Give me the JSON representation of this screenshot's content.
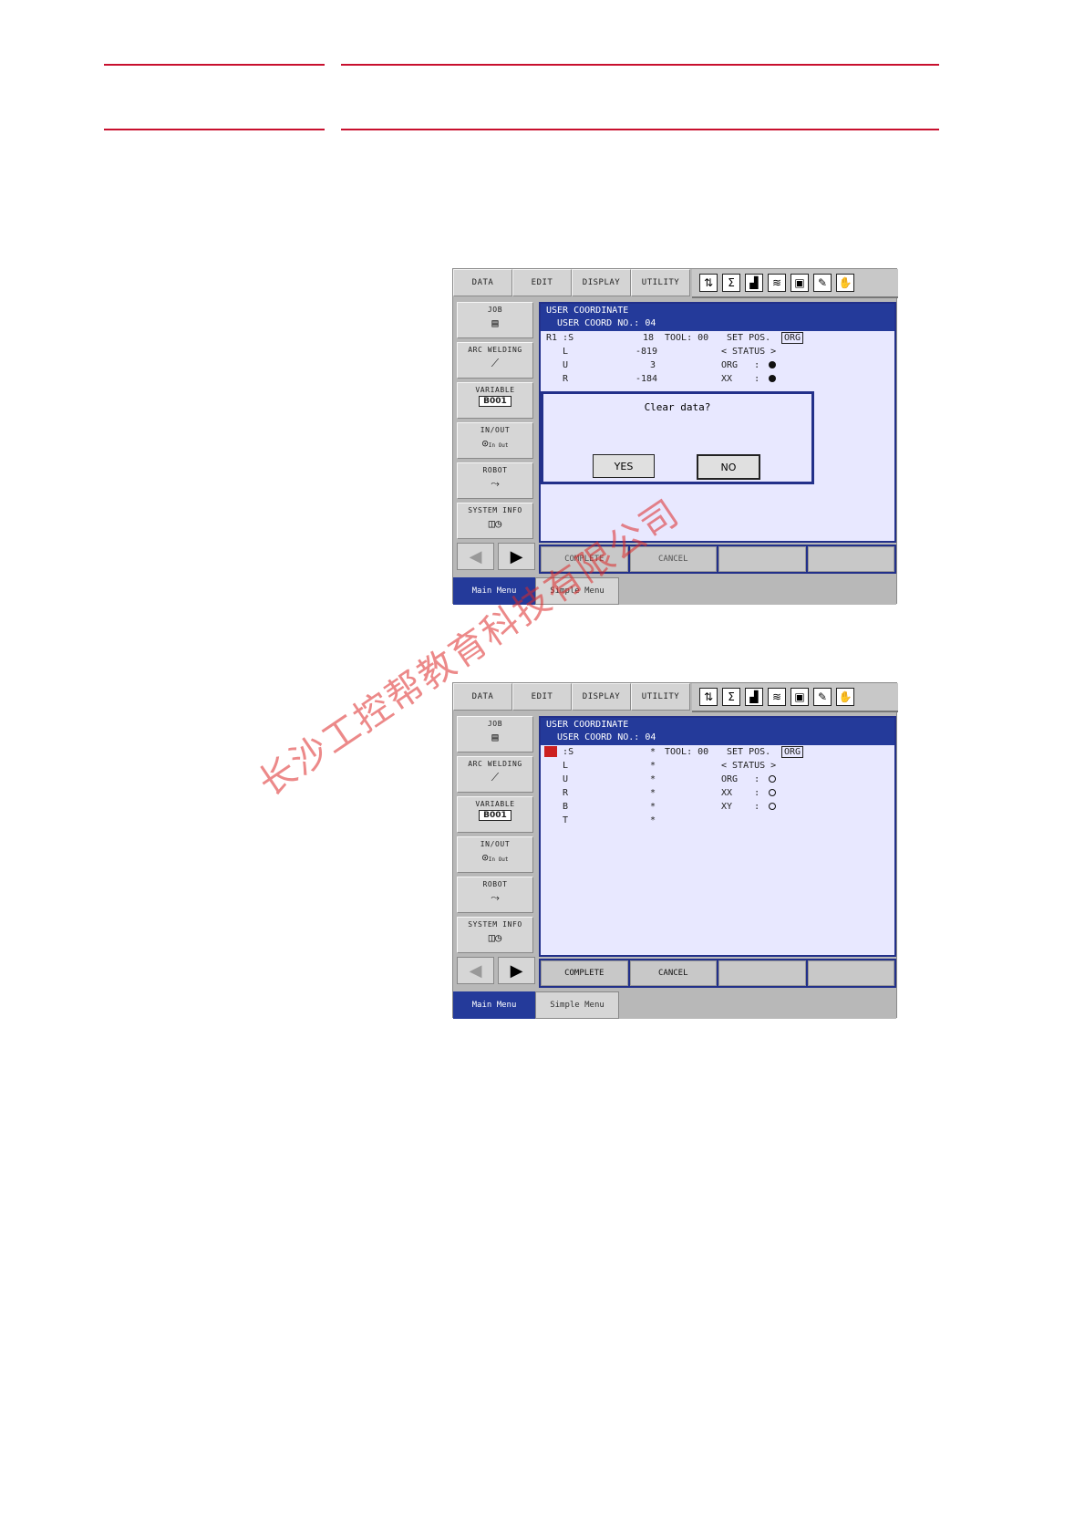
{
  "screens": [
    {
      "menu": [
        "DATA",
        "EDIT",
        "DISPLAY",
        "UTILITY"
      ],
      "side": [
        {
          "label": "JOB"
        },
        {
          "label": "ARC WELDING"
        },
        {
          "label": "VARIABLE",
          "tag": "B001"
        },
        {
          "label": "IN/OUT",
          "small": "In  Out"
        },
        {
          "label": "ROBOT"
        },
        {
          "label": "SYSTEM INFO"
        }
      ],
      "pane": {
        "title1": "USER COORDINATE",
        "title2": "USER COORD NO.: 04",
        "rows": [
          {
            "c1": "R1 :S",
            "c2": "18",
            "c3": "TOOL: 00",
            "c4": "SET POS.",
            "c5": "ORG"
          },
          {
            "c1": "   L",
            "c2": "-819",
            "c3": "< STATUS >"
          },
          {
            "c1": "   U",
            "c2": "3",
            "c3": "ORG   :"
          },
          {
            "c1": "   R",
            "c2": "-184",
            "c3": "XX    :"
          }
        ]
      },
      "dialog": {
        "message": "Clear data?",
        "yes": "YES",
        "no": "NO"
      },
      "soft": [
        "COMPLETE",
        "CANCEL",
        "",
        ""
      ],
      "bottom": {
        "main": "Main Menu",
        "simple": "Simple Menu"
      }
    },
    {
      "menu": [
        "DATA",
        "EDIT",
        "DISPLAY",
        "UTILITY"
      ],
      "side": [
        {
          "label": "JOB"
        },
        {
          "label": "ARC WELDING"
        },
        {
          "label": "VARIABLE",
          "tag": "B001"
        },
        {
          "label": "IN/OUT",
          "small": "In  Out"
        },
        {
          "label": "ROBOT"
        },
        {
          "label": "SYSTEM INFO"
        }
      ],
      "pane": {
        "title1": "USER COORDINATE",
        "title2": "USER COORD NO.: 04",
        "rows": [
          {
            "c1": "   :S",
            "c2": "*",
            "c3": "TOOL: 00",
            "c4": "SET POS.",
            "c5": "ORG"
          },
          {
            "c1": "   L",
            "c2": "*",
            "c3": "< STATUS >"
          },
          {
            "c1": "   U",
            "c2": "*",
            "c3": "ORG   :"
          },
          {
            "c1": "   R",
            "c2": "*",
            "c3": "XX    :"
          },
          {
            "c1": "   B",
            "c2": "*",
            "c3": "XY    :"
          },
          {
            "c1": "   T",
            "c2": "*",
            "c3": ""
          }
        ]
      },
      "soft": [
        "COMPLETE",
        "CANCEL",
        "",
        ""
      ],
      "bottom": {
        "main": "Main Menu",
        "simple": "Simple Menu"
      }
    }
  ],
  "watermark": "长沙工控帮教育科技有限公司"
}
